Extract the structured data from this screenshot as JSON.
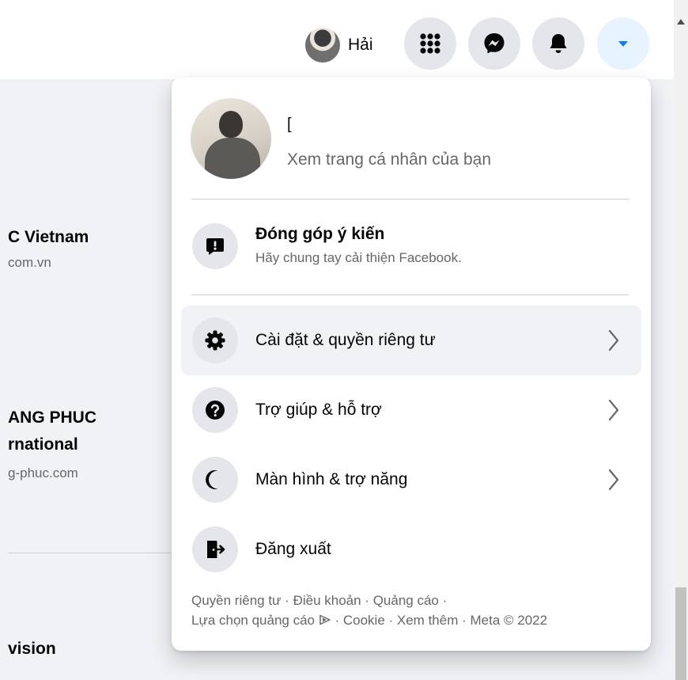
{
  "topbar": {
    "profile_name": "Hải",
    "icons": [
      "menu-grid-icon",
      "messenger-icon",
      "bell-icon",
      "caret-down-icon"
    ],
    "accent_color": "#1877f2"
  },
  "background_page": {
    "entries": [
      {
        "title": "C Vietnam",
        "subtitle": "com.vn"
      },
      {
        "title_line1": "ANG PHUC",
        "title_line2": "rnational",
        "subtitle": "g-phuc.com"
      },
      {
        "title": "vision"
      }
    ]
  },
  "dropdown": {
    "profile": {
      "name": "[",
      "link": "Xem trang cá nhân của bạn"
    },
    "feedback": {
      "title": "Đóng góp ý kiến",
      "subtitle": "Hãy chung tay cải thiện Facebook.",
      "icon": "feedback-icon"
    },
    "items": [
      {
        "label": "Cài đặt & quyền riêng tư",
        "icon": "gear-icon",
        "has_chevron": true
      },
      {
        "label": "Trợ giúp & hỗ trợ",
        "icon": "help-icon",
        "has_chevron": true
      },
      {
        "label": "Màn hình & trợ năng",
        "icon": "moon-icon",
        "has_chevron": true
      },
      {
        "label": "Đăng xuất",
        "icon": "logout-icon",
        "has_chevron": false
      }
    ],
    "footer": {
      "links": [
        "Quyền riêng tư",
        "Điều khoản",
        "Quảng cáo",
        "Lựa chọn quảng cáo"
      ],
      "cookie": "Cookie",
      "more": "Xem thêm",
      "copyright": "Meta © 2022",
      "separator": " · "
    }
  }
}
